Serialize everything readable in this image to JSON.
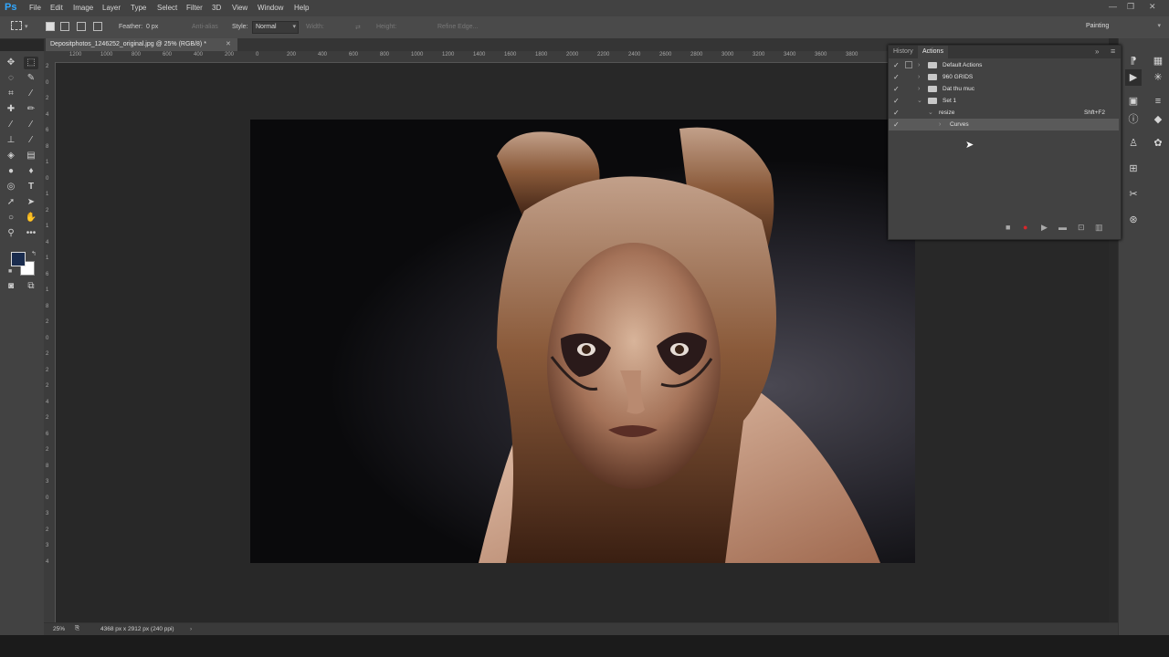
{
  "app": {
    "logo": "Ps"
  },
  "menu": [
    "File",
    "Edit",
    "Image",
    "Layer",
    "Type",
    "Select",
    "Filter",
    "3D",
    "View",
    "Window",
    "Help"
  ],
  "window_controls": {
    "minimize": "—",
    "restore": "❐",
    "close": "✕"
  },
  "options": {
    "feather_label": "Feather:",
    "feather_value": "0 px",
    "anti_alias": "Anti-alias",
    "style_label": "Style:",
    "style_value": "Normal",
    "width_label": "Width:",
    "height_label": "Height:",
    "refine_edge": "Refine Edge...",
    "workspace": "Painting"
  },
  "document": {
    "tab_title": "Depositphotos_1246252_original.jpg @ 25% (RGB/8) *",
    "close": "✕"
  },
  "ruler_h": [
    "1200",
    "1000",
    "800",
    "600",
    "400",
    "200",
    "0",
    "200",
    "400",
    "600",
    "800",
    "1000",
    "1200",
    "1400",
    "1600",
    "1800",
    "2000",
    "2200",
    "2400",
    "2600",
    "2800",
    "3000",
    "3200",
    "3400",
    "3600",
    "3800"
  ],
  "ruler_v": [
    "2",
    "0",
    "2",
    "4",
    "6",
    "8",
    "1",
    "0",
    "1",
    "2",
    "1",
    "4",
    "1",
    "6",
    "1",
    "8",
    "2",
    "0",
    "2",
    "2",
    "2",
    "4",
    "2",
    "6",
    "2",
    "8",
    "3",
    "0",
    "3",
    "2",
    "3",
    "4"
  ],
  "panel": {
    "tabs": [
      "History",
      "Actions"
    ],
    "rows": [
      {
        "label": "Default Actions",
        "shortcut": ""
      },
      {
        "label": "960 GRIDS",
        "shortcut": ""
      },
      {
        "label": "Dat thu muc",
        "shortcut": ""
      },
      {
        "label": "Set 1",
        "shortcut": ""
      },
      {
        "label": "resize",
        "shortcut": "Shft+F2"
      },
      {
        "label": "Curves",
        "shortcut": ""
      }
    ],
    "check": "✓"
  },
  "status": {
    "zoom": "25%",
    "doc_info": "4368 px x 2912 px (240 ppi)"
  },
  "colors": {
    "foreground": "#1a2c4e",
    "background": "#ffffff",
    "accent": "#31a8ff",
    "record": "#d9262b"
  }
}
